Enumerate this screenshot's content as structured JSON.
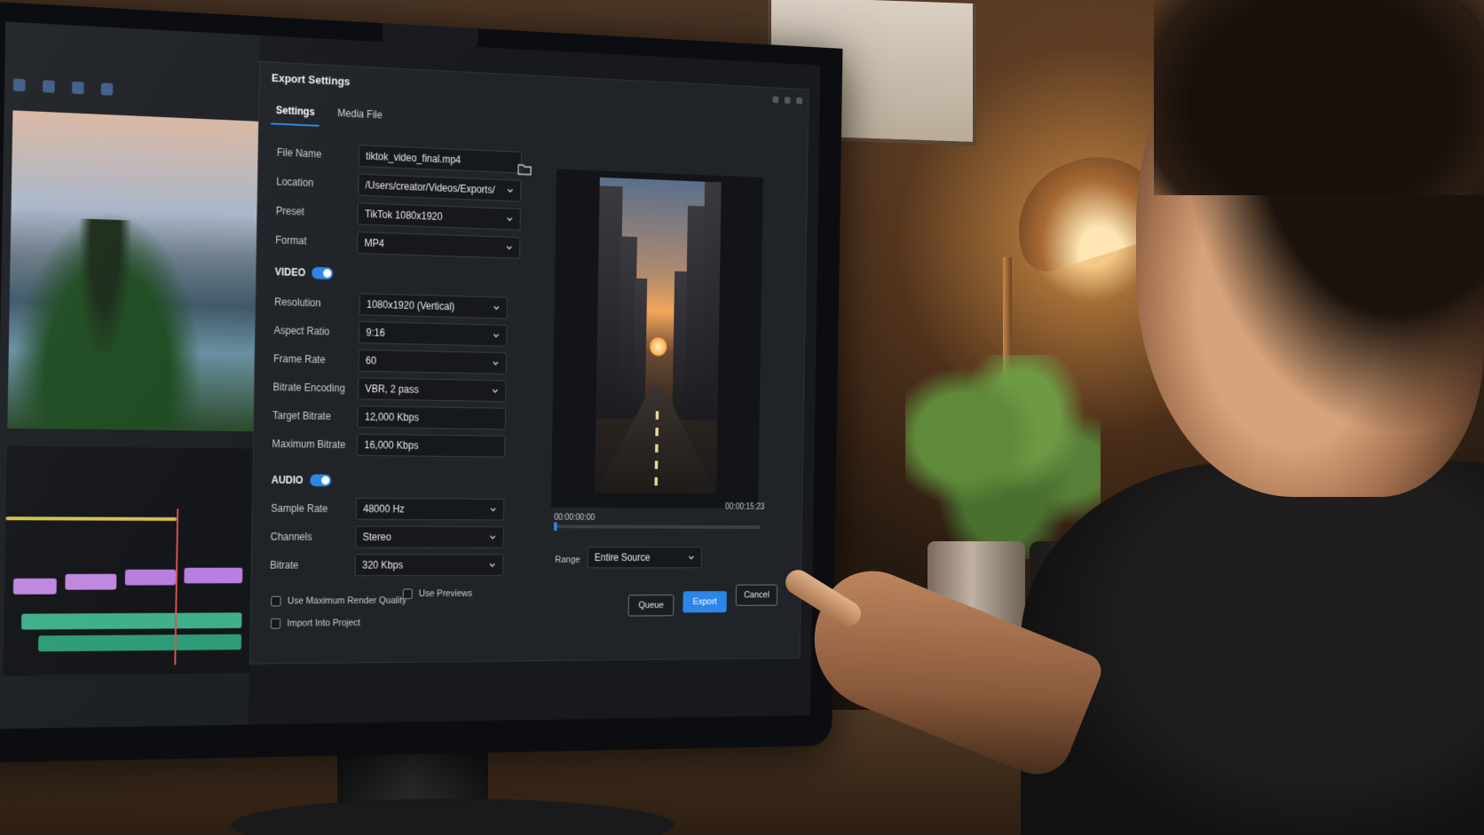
{
  "dialog": {
    "title": "Export Settings",
    "tabs": [
      {
        "label": "Settings",
        "active": true
      },
      {
        "label": "Media File",
        "active": false
      }
    ]
  },
  "general": {
    "file_name": {
      "label": "File Name",
      "value": "tiktok_video_final.mp4"
    },
    "location": {
      "label": "Location",
      "value": "/Users/creator/Videos/Exports/"
    },
    "preset": {
      "label": "Preset",
      "value": "TikTok 1080x1920"
    },
    "format": {
      "label": "Format",
      "value": "MP4"
    }
  },
  "video": {
    "heading": "VIDEO",
    "enabled": true,
    "resolution": {
      "label": "Resolution",
      "value": "1080x1920 (Vertical)"
    },
    "aspect_ratio": {
      "label": "Aspect Ratio",
      "value": "9:16"
    },
    "frame_rate": {
      "label": "Frame Rate",
      "value": "60"
    },
    "bitrate_encoding": {
      "label": "Bitrate Encoding",
      "value": "VBR, 2 pass"
    },
    "target_bitrate": {
      "label": "Target Bitrate",
      "value": "12,000 Kbps"
    },
    "maximum_bitrate": {
      "label": "Maximum Bitrate",
      "value": "16,000 Kbps"
    }
  },
  "audio": {
    "heading": "AUDIO",
    "enabled": true,
    "sample_rate": {
      "label": "Sample Rate",
      "value": "48000 Hz"
    },
    "channels": {
      "label": "Channels",
      "value": "Stereo"
    },
    "bitrate": {
      "label": "Bitrate",
      "value": "320 Kbps"
    }
  },
  "options": {
    "max_render_quality": {
      "label": "Use Maximum Render Quality",
      "checked": false
    },
    "use_previews": {
      "label": "Use Previews",
      "checked": false
    },
    "import_into_project": {
      "label": "Import Into Project",
      "checked": false
    }
  },
  "preview": {
    "time_start": "00:00:00:00",
    "time_end": "00:00:15:23",
    "range_label": "Range",
    "range_value": "Entire Source"
  },
  "buttons": {
    "queue": "Queue",
    "export": "Export",
    "cancel": "Cancel"
  },
  "colors": {
    "accent": "#2d86e6",
    "dialog_bg": "#202328",
    "field_bg": "#16181c"
  },
  "icons": [
    "chevron-down-icon",
    "folder-icon"
  ]
}
